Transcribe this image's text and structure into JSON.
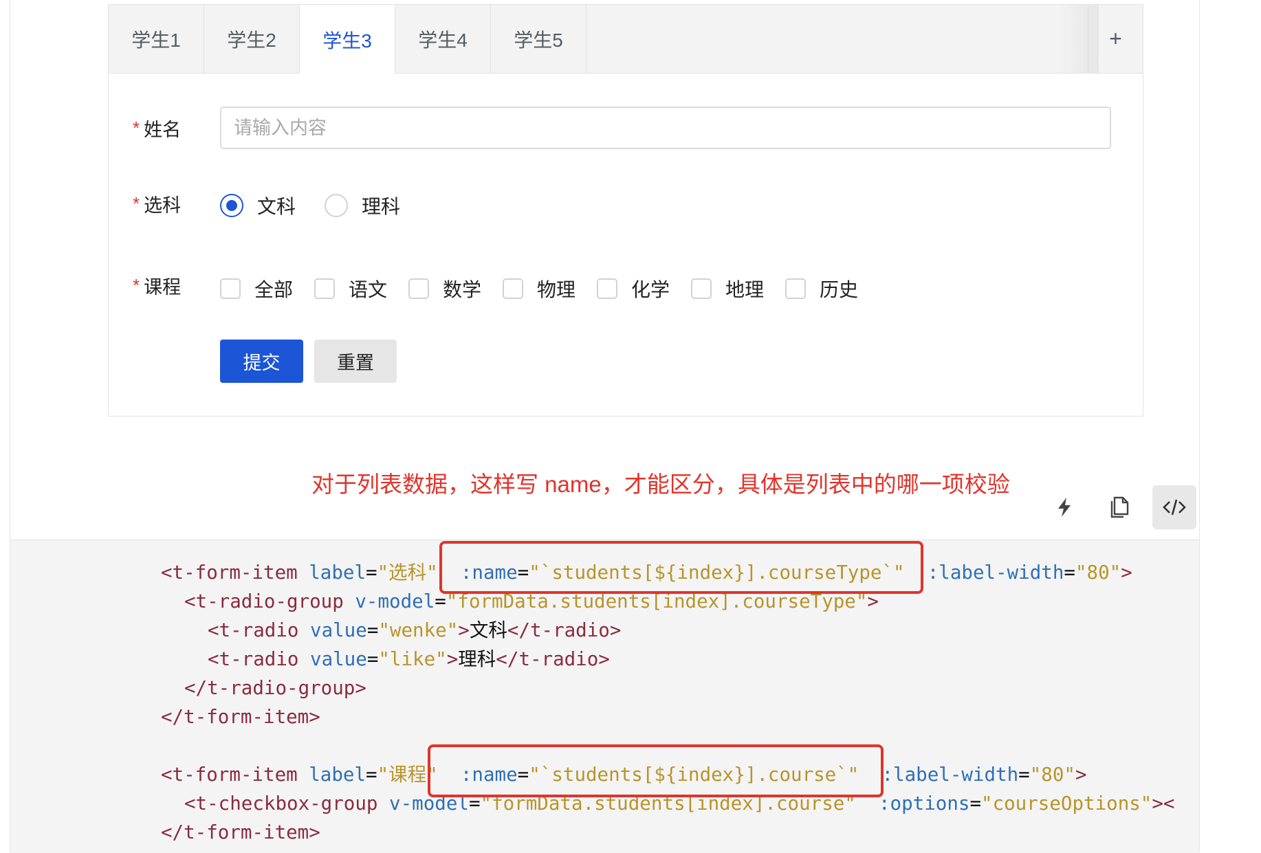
{
  "tabs": [
    {
      "label": "学生1",
      "active": false
    },
    {
      "label": "学生2",
      "active": false
    },
    {
      "label": "学生3",
      "active": true
    },
    {
      "label": "学生4",
      "active": false
    },
    {
      "label": "学生5",
      "active": false
    }
  ],
  "tab_add_label": "+",
  "form": {
    "required_mark": "*",
    "name_label": "姓名",
    "name_placeholder": "请输入内容",
    "name_value": "",
    "course_type_label": "选科",
    "course_type_options": [
      {
        "label": "文科",
        "checked": true
      },
      {
        "label": "理科",
        "checked": false
      }
    ],
    "course_label": "课程",
    "course_options": [
      "全部",
      "语文",
      "数学",
      "物理",
      "化学",
      "地理",
      "历史"
    ],
    "submit_label": "提交",
    "reset_label": "重置"
  },
  "annotation": "对于列表数据，这样写 name，才能区分，具体是列表中的哪一项校验",
  "toolbar": {
    "icons": [
      "lightning-icon",
      "copy-icon",
      "code-icon"
    ],
    "active": "code-icon"
  },
  "colors": {
    "primary": "#1c55d6",
    "annotation": "#e0342b",
    "tag": "#8a2b3f",
    "attribute": "#2f6fb5",
    "string": "#b8942a"
  },
  "code": {
    "l1": {
      "t1": "<t-form-item",
      "a1": "label",
      "e1": "=",
      "s1": "\"选科\"",
      "a2": ":name",
      "e2": "=",
      "s2": "\"`students[${index}].courseType`\"",
      "a3": ":label-width",
      "e3": "=",
      "s3": "\"80\"",
      "t2": ">"
    },
    "l2": {
      "t1": "<t-radio-group",
      "a1": "v-model",
      "e1": "=",
      "s1": "\"formData.students[index].courseType\"",
      "t2": ">"
    },
    "l3": {
      "t1": "<t-radio",
      "a1": "value",
      "e1": "=",
      "s1": "\"wenke\"",
      "t2": ">",
      "x1": "文科",
      "t3": "</t-radio>"
    },
    "l4": {
      "t1": "<t-radio",
      "a1": "value",
      "e1": "=",
      "s1": "\"like\"",
      "t2": ">",
      "x1": "理科",
      "t3": "</t-radio>"
    },
    "l5": {
      "t1": "</t-radio-group>"
    },
    "l6": {
      "t1": "</t-form-item>"
    },
    "l8": {
      "t1": "<t-form-item",
      "a1": "label",
      "e1": "=",
      "s1": "\"课程\"",
      "a2": ":name",
      "e2": "=",
      "s2": "\"`students[${index}].course`\"",
      "a3": ":label-width",
      "e3": "=",
      "s3": "\"80\"",
      "t2": ">"
    },
    "l9": {
      "t1": "<t-checkbox-group",
      "a1": "v-model",
      "e1": "=",
      "s1": "\"formData.students[index].course\"",
      "a2": ":options",
      "e2": "=",
      "s2": "\"courseOptions\"",
      "t2": "><"
    },
    "l10": {
      "t1": "</t-form-item>"
    }
  }
}
